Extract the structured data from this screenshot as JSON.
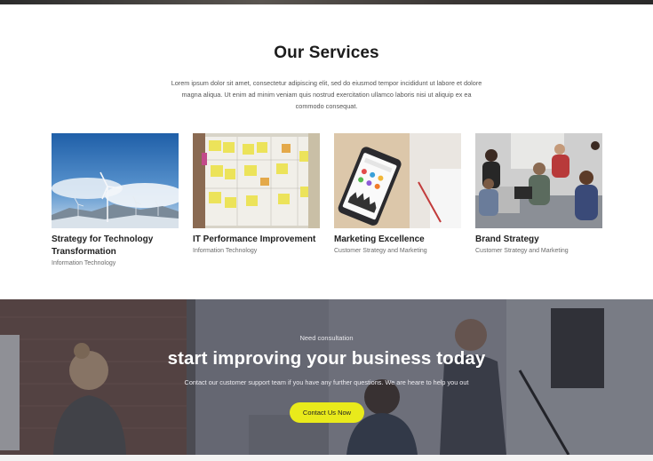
{
  "services": {
    "heading": "Our Services",
    "intro_line1": "Lorem ipsum dolor sit amet, consectetur adipiscing elit, sed do eiusmod tempor incididunt ut labore et dolore",
    "intro_line2": "magna aliqua. Ut enim ad minim veniam quis nostrud exercitation ullamco laboris nisi ut aliquip ex ea",
    "intro_line3": "commodo consequat.",
    "cards": [
      {
        "title_line1": "Strategy for Technology",
        "title_line2": "Transformation",
        "category": "Information Technology",
        "image": "wind-turbines-photo"
      },
      {
        "title_line1": "IT Performance Improvement",
        "title_line2": "",
        "category": "Information Technology",
        "image": "sticky-notes-board-photo"
      },
      {
        "title_line1": "Marketing Excellence",
        "title_line2": "",
        "category": "Customer Strategy and Marketing",
        "image": "smartphone-on-desk-photo"
      },
      {
        "title_line1": "Brand Strategy",
        "title_line2": "",
        "category": "Customer Strategy and Marketing",
        "image": "team-meeting-photo"
      }
    ]
  },
  "cta": {
    "kicker": "Need consultation",
    "headline": "start improving your business today",
    "support": "Contact our customer support team if you have any further questions. We are heare to help you out",
    "button_label": "Contact Us Now",
    "button_color": "#e9ea1b",
    "background_image": "office-team-working-photo"
  }
}
